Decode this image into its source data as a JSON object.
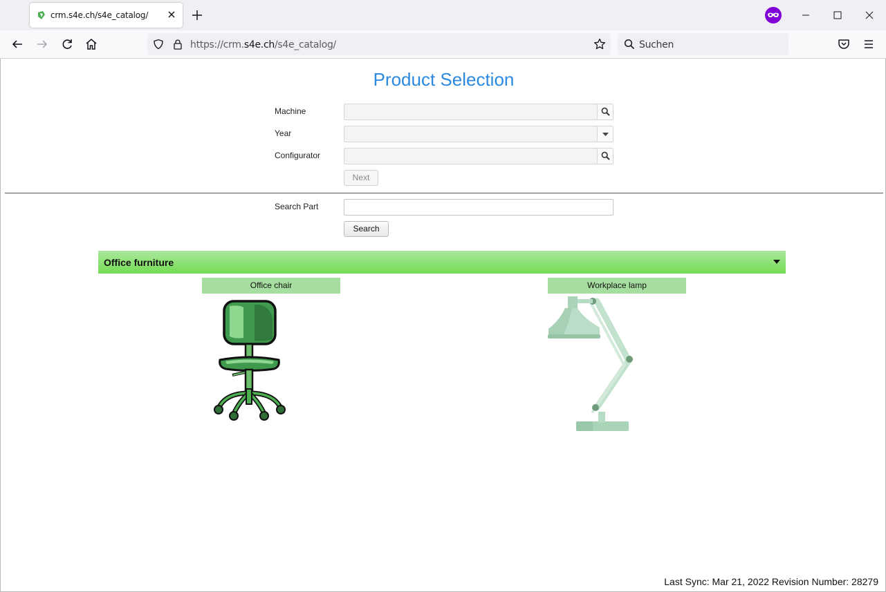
{
  "browser": {
    "tab": {
      "title": "crm.s4e.ch/s4e_catalog/"
    },
    "url": {
      "prefix": "https://crm.",
      "domain": "s4e.ch",
      "path": "/s4e_catalog/"
    },
    "search_placeholder": "Suchen"
  },
  "page": {
    "title": "Product Selection",
    "form": {
      "machine_label": "Machine",
      "machine_value": "",
      "year_label": "Year",
      "year_value": "",
      "configurator_label": "Configurator",
      "configurator_value": "",
      "next_label": "Next"
    },
    "part_search": {
      "label": "Search Part",
      "value": "",
      "button_label": "Search"
    },
    "category": {
      "label": "Office furniture",
      "products": [
        {
          "label": "Office chair",
          "image": "office-chair"
        },
        {
          "label": "Workplace lamp",
          "image": "desk-lamp"
        }
      ]
    },
    "footer": "Last Sync: Mar 21, 2022 Revision Number: 28279"
  },
  "colors": {
    "title": "#2b8ae0",
    "category_bar": "#74dc54",
    "product_label_bg": "#a6dea0",
    "private_browsing": "#8000d7"
  }
}
